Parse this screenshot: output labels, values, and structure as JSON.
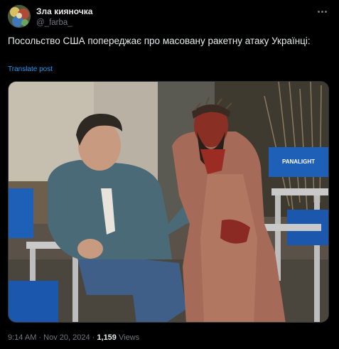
{
  "author": {
    "display_name": "Зла кияночка",
    "handle": "@_farba_"
  },
  "post": {
    "text": "Посольство США попереджає про масовану ракетну атаку Українці:",
    "translate_label": "Translate post"
  },
  "media": {
    "chair_label": "PANALIGHT"
  },
  "meta": {
    "time": "9:14 AM",
    "separator": "·",
    "date": "Nov 20, 2024",
    "views_count": "1,159",
    "views_label": "Views"
  },
  "colors": {
    "background": "#000000",
    "primary_text": "#e7e9ea",
    "secondary_text": "#71767b",
    "link": "#1d9bf0",
    "chair_blue": "#1e5fb8"
  },
  "icons": {
    "more": "more-dots-icon"
  }
}
